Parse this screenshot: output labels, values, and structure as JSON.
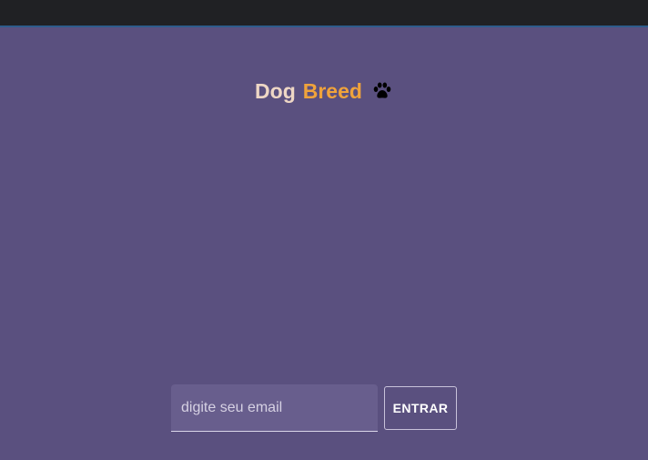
{
  "brand": {
    "word1": "Dog",
    "word2": "Breed",
    "icon": "paw-icon"
  },
  "login": {
    "email_placeholder": "digite seu email",
    "email_value": "",
    "submit_label": "ENTRAR"
  },
  "colors": {
    "background": "#5a507f",
    "topbar": "#202124",
    "accent_line": "#2e5c8c",
    "brand_dog": "#eed7c5",
    "brand_breed": "#f0a33b"
  }
}
